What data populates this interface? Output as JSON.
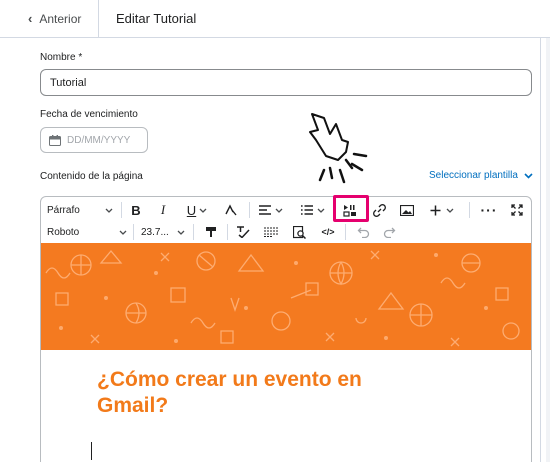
{
  "topbar": {
    "back_label": "Anterior",
    "title": "Editar Tutorial"
  },
  "form": {
    "name_label": "Nombre",
    "required_mark": "*",
    "name_value": "Tutorial",
    "due_label": "Fecha de vencimiento",
    "due_placeholder": "DD/MM/YYYY",
    "content_label": "Contenido de la página",
    "template_link": "Seleccionar plantilla"
  },
  "toolbar": {
    "paragraph": "Párrafo",
    "bold": "B",
    "italic": "I",
    "underline": "U",
    "font": "Roboto",
    "size": "23.7...",
    "source": "</>"
  },
  "editor": {
    "heading": "¿Cómo crear un evento en Gmail?"
  },
  "colors": {
    "accent_orange": "#f47a20",
    "heading_orange": "#f27a1a",
    "highlight": "#e5006e",
    "link": "#006fbf"
  },
  "icons": [
    "chevron-left-icon",
    "calendar-icon",
    "chevron-down-icon",
    "strikethrough-icon",
    "align-icon",
    "list-icon",
    "insert-media-icon",
    "link-icon",
    "image-icon",
    "plus-icon",
    "more-icon",
    "fullscreen-icon",
    "format-painter-icon",
    "spellcheck-icon",
    "lines-icon",
    "preview-icon",
    "undo-icon",
    "redo-icon"
  ]
}
